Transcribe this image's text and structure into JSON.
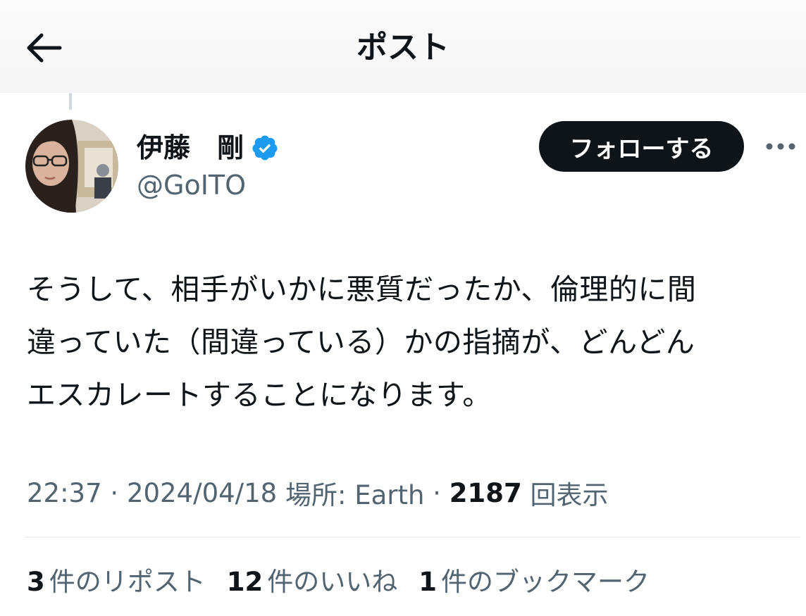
{
  "header": {
    "title": "ポスト",
    "back_icon": "arrow-left-icon"
  },
  "author": {
    "display_name": "伊藤　剛",
    "handle": "@GoITO",
    "verified": true,
    "badge_color": "#1d9bf0",
    "avatar_icon": "profile-photo"
  },
  "actions": {
    "follow_label": "フォローする",
    "more_icon": "more-horizontal-icon"
  },
  "post": {
    "lines": [
      "そうして、相手がいかに悪質だったか、倫理的に間",
      "違っていた（間違っている）かの指摘が、どんどん",
      "エスカレートすることになります。"
    ]
  },
  "meta": {
    "time": "22:37",
    "sep1": " · ",
    "date": "2024/04/18",
    "location": " 場所: Earth",
    "sep2": " · ",
    "views_count": "2187",
    "views_label": " 回表示"
  },
  "stats": [
    {
      "count": "3",
      "label": "件のリポスト"
    },
    {
      "count": "12",
      "label": "件のいいね"
    },
    {
      "count": "1",
      "label": "件のブックマーク"
    }
  ],
  "colors": {
    "text": "#0f1419",
    "secondary": "#536471",
    "button_bg": "#0f1419",
    "verified": "#1d9bf0"
  }
}
